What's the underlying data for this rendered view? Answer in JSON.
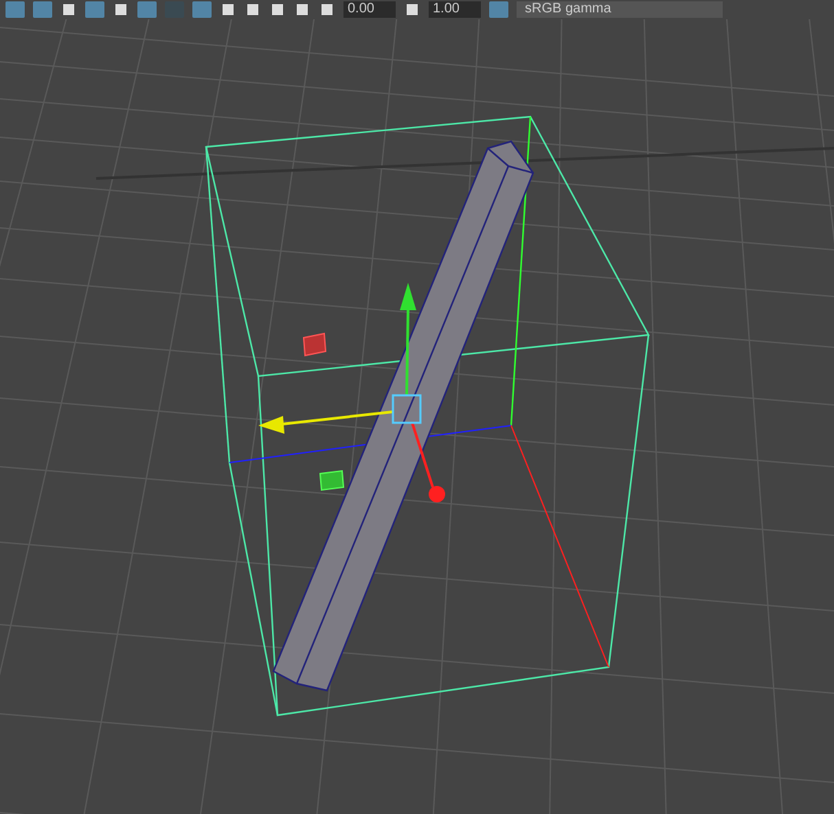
{
  "toolbar": {
    "fields": [
      {
        "value": "0.00"
      },
      {
        "value": "1.00"
      }
    ],
    "color_space": "sRGB gamma"
  }
}
